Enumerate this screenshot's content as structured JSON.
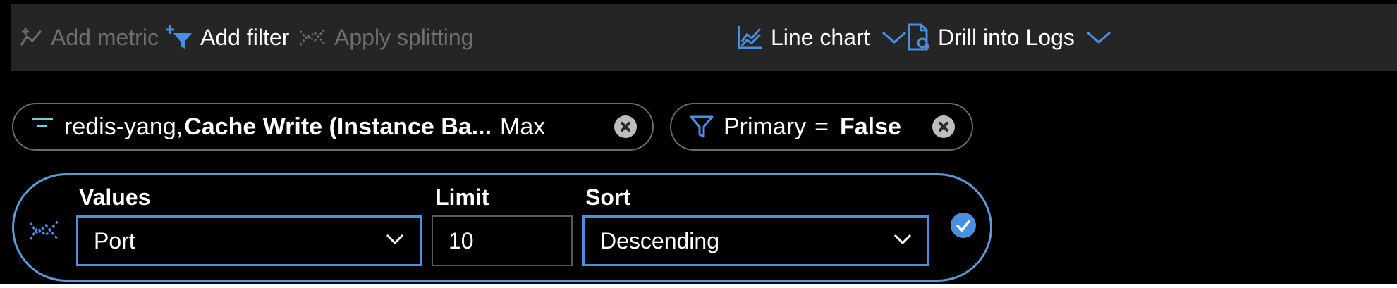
{
  "toolbar": {
    "add_metric": "Add metric",
    "add_filter": "Add filter",
    "apply_splitting": "Apply splitting",
    "chart_type": "Line chart",
    "drill_logs": "Drill into Logs"
  },
  "metric_pill": {
    "resource": "redis-yang,",
    "metric": "Cache Write (Instance Ba...",
    "aggregation": "Max"
  },
  "filter_pill": {
    "property": "Primary",
    "operator": "=",
    "value": "False"
  },
  "splitting": {
    "values_label": "Values",
    "values_selected": "Port",
    "limit_label": "Limit",
    "limit_value": "10",
    "sort_label": "Sort",
    "sort_selected": "Descending"
  },
  "colors": {
    "accent": "#4a90e2",
    "toolbar_bg": "#252526",
    "disabled_text": "#6e6e6e",
    "metric_icon": "#6fd0e0"
  },
  "icons": [
    "add-metric-icon",
    "add-filter-icon",
    "apply-splitting-icon",
    "line-chart-icon",
    "drill-logs-icon",
    "chevron-down-icon",
    "metric-icon",
    "filter-icon",
    "close-icon",
    "splitting-icon",
    "check-icon"
  ]
}
